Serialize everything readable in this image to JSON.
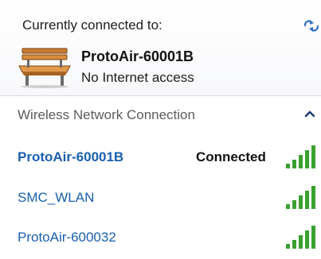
{
  "header": {
    "label": "Currently connected to:",
    "refresh_icon": "refresh-icon"
  },
  "current_connection": {
    "icon": "bench-icon",
    "name": "ProtoAir-60001B",
    "status": "No Internet access"
  },
  "section": {
    "title": "Wireless Network Connection",
    "collapse_icon": "chevron-up-icon"
  },
  "networks": [
    {
      "name": "ProtoAir-60001B",
      "state": "Connected",
      "signal_bars": 5
    },
    {
      "name": "SMC_WLAN",
      "state": "",
      "signal_bars": 5
    },
    {
      "name": "ProtoAir-600032",
      "state": "",
      "signal_bars": 5
    }
  ],
  "colors": {
    "link_blue": "#1a5fb0",
    "signal_green": "#3aa12f",
    "refresh_blue": "#2f6fc4"
  }
}
